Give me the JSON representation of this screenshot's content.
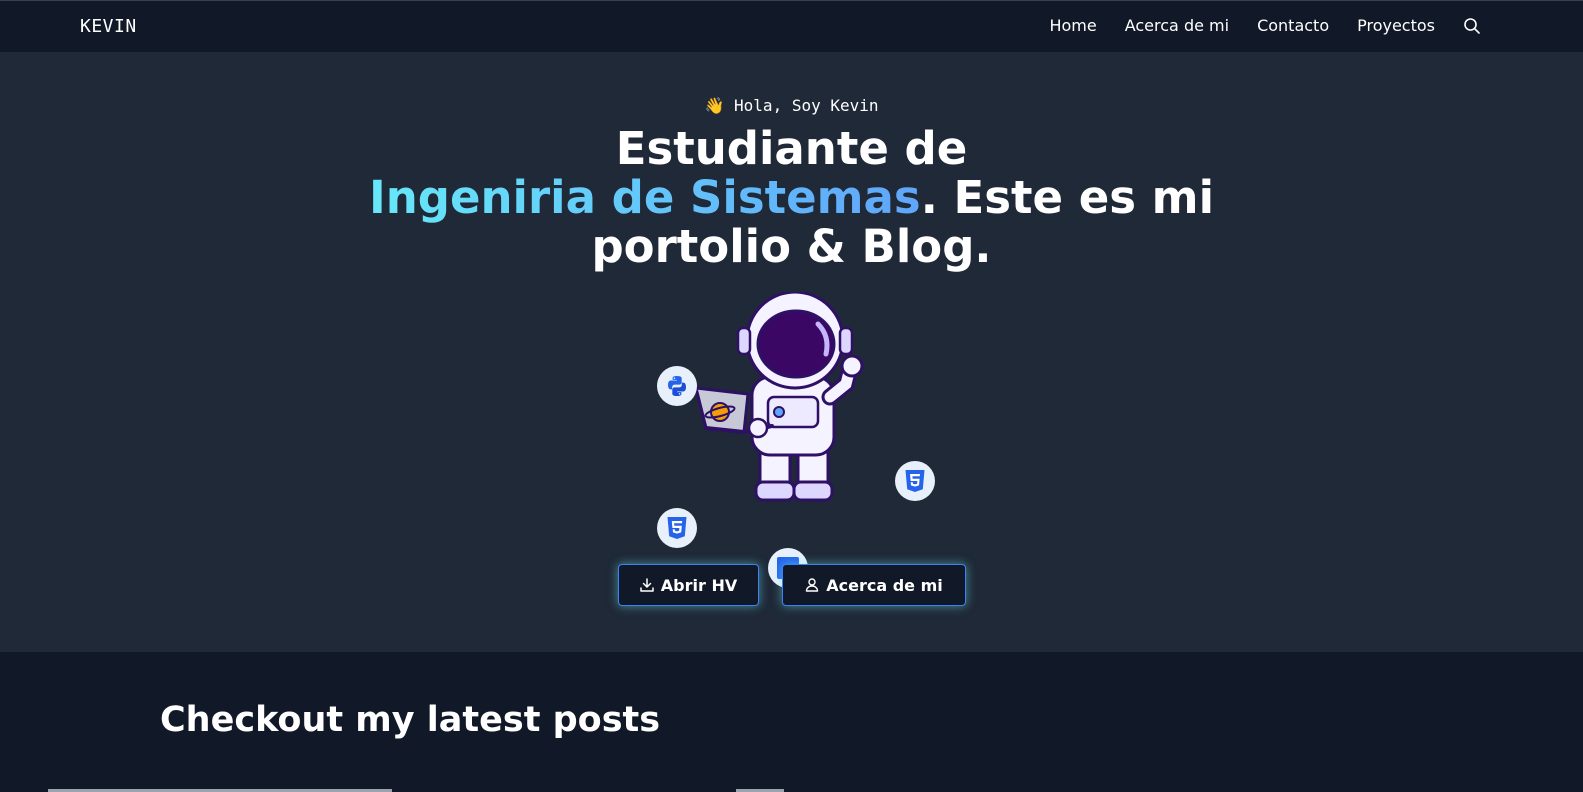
{
  "header": {
    "brand": "KEVIN",
    "nav": [
      "Home",
      "Acerca de mi",
      "Contacto",
      "Proyectos"
    ],
    "search_icon": "search-icon"
  },
  "hero": {
    "greeting_emoji": "👋",
    "greeting": "Hola, Soy Kevin",
    "headline_line1": "Estudiante de",
    "headline_accent": "Ingeniria de Sistemas",
    "headline_rest": ". Este es mi",
    "headline_line3": "portolio & Blog.",
    "accent_gradient": [
      "#67e8f9",
      "#60a5fa"
    ],
    "tech_icons": [
      "python-icon",
      "html5-icon",
      "css3-icon",
      "javascript-icon"
    ],
    "illustration": "astronaut-with-laptop",
    "buttons": {
      "hv_label": "Abrir HV",
      "hv_icon": "download-icon",
      "about_label": "Acerca de mi",
      "about_icon": "user-icon"
    }
  },
  "posts": {
    "title": "Checkout my latest posts"
  },
  "colors": {
    "nav_bg": "#111827",
    "hero_bg": "#1f2937",
    "section_bg": "#111827",
    "button_glow": "#67e8f9",
    "button_border": "#3b82f6",
    "tech_icon_blue": "#2563eb"
  }
}
